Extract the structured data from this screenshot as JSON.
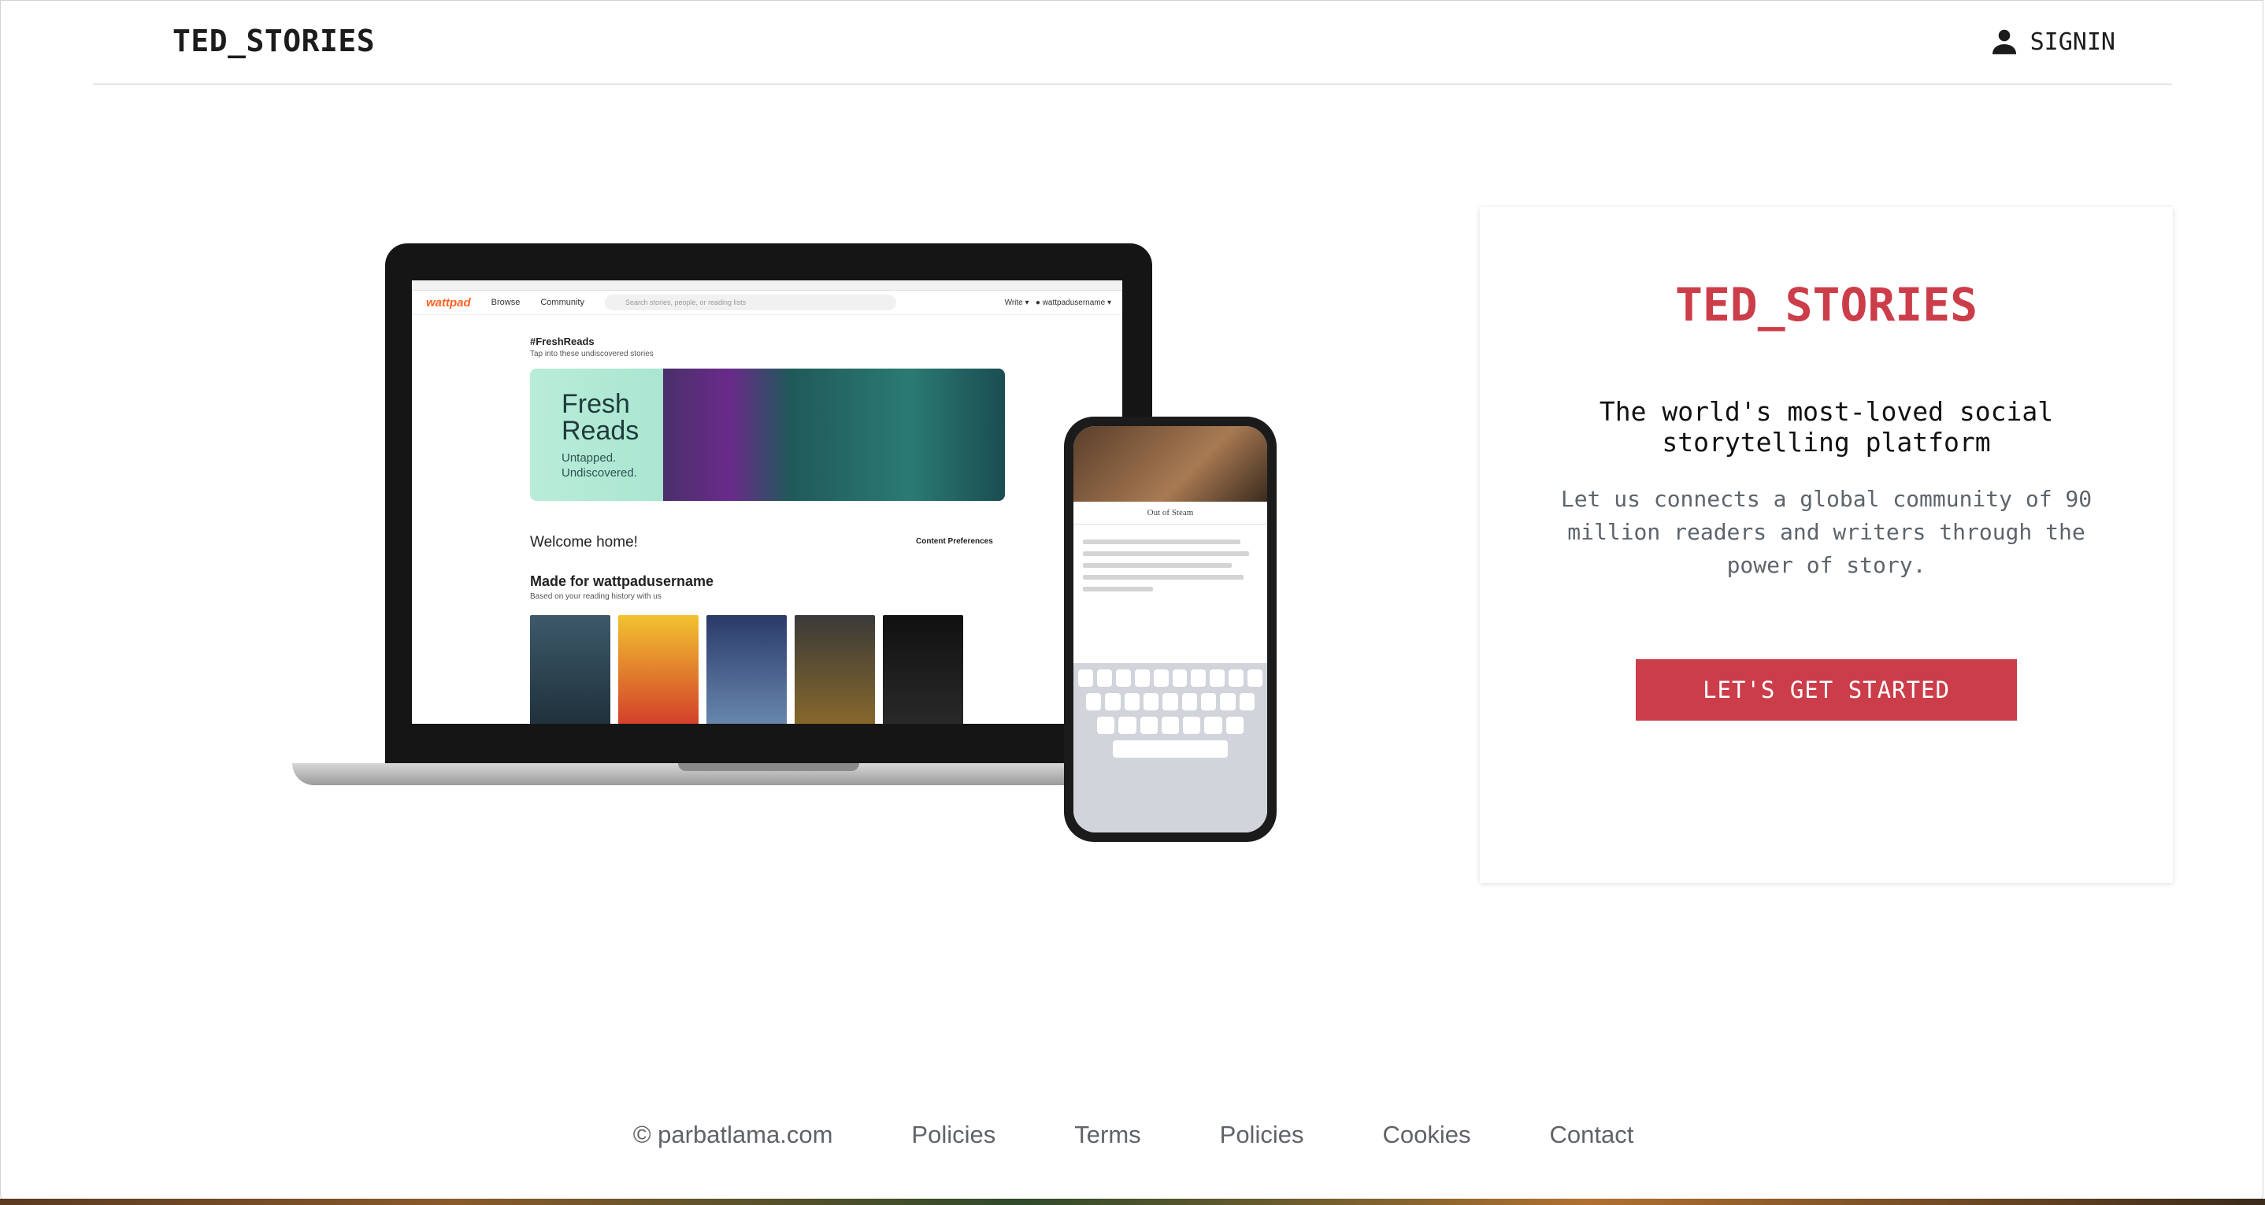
{
  "header": {
    "brand": "TED_STORIES",
    "signin_label": "SIGNIN",
    "signin_icon": "person-icon"
  },
  "hero": {
    "laptop_nav": {
      "logo": "wattpad",
      "browse": "Browse",
      "community": "Community",
      "search_placeholder": "Search stories, people, or reading lists",
      "write": "Write",
      "username": "wattpadusername"
    },
    "fresh_reads_heading": "#FreshReads",
    "fresh_reads_sub": "Tap into these undiscovered stories",
    "banner_title_line1": "Fresh",
    "banner_title_line2": "Reads",
    "banner_sub_line1": "Untapped.",
    "banner_sub_line2": "Undiscovered.",
    "welcome": "Welcome home!",
    "content_prefs": "Content Preferences",
    "made_for": "Made for wattpadusername",
    "made_for_sub": "Based on your reading history with us",
    "phone_title": "Out of Steam"
  },
  "card": {
    "brand": "TED_STORIES",
    "tagline": "The world's most-loved social storytelling platform",
    "description": "Let us connects a global community of 90 million readers and writers through the power of story.",
    "cta_label": "LET'S GET STARTED",
    "accent_color": "#cc3d4a"
  },
  "footer": {
    "copyright": "© parbatlama.com",
    "links": [
      "Policies",
      "Terms",
      "Policies",
      "Cookies",
      "Contact"
    ]
  }
}
